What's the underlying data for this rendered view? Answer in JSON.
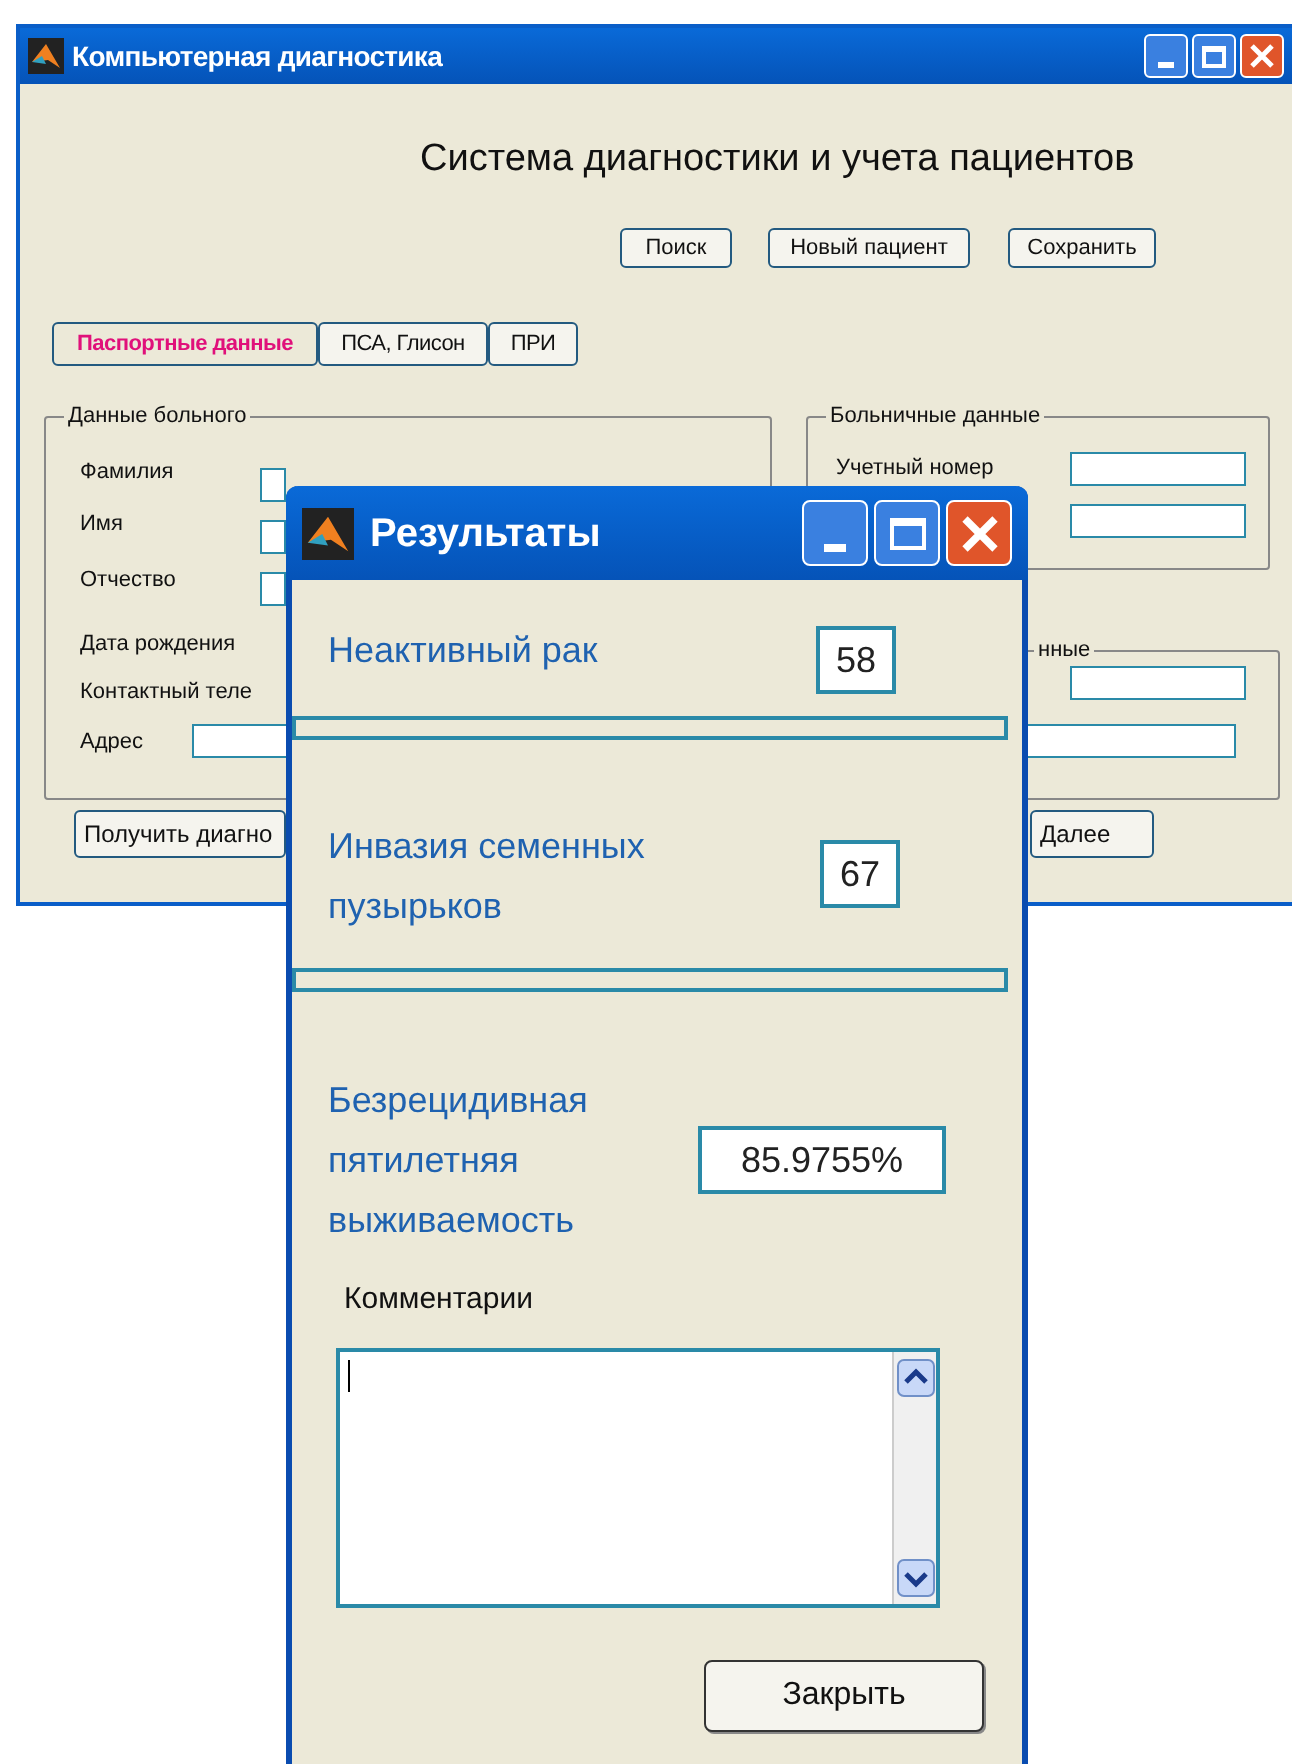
{
  "main_window": {
    "title": "Компьютерная диагностика",
    "heading": "Система диагностики и учета пациентов",
    "toolbar_buttons": [
      "Поиск",
      "Новый пациент",
      "Сохранить"
    ],
    "tabs": [
      {
        "label": "Паспортные данные",
        "selected": true
      },
      {
        "label": "ПСА, Глисон",
        "selected": false
      },
      {
        "label": "ПРИ",
        "selected": false
      }
    ],
    "patient_group": {
      "title": "Данные больного",
      "fields": [
        "Фамилия",
        "Имя",
        "Отчество",
        "Дата рождения",
        "Контактный теле",
        "Адрес"
      ]
    },
    "hospital_group": {
      "title": "Больничные данные",
      "fields": [
        "Учетный номер"
      ]
    },
    "third_group": {
      "title": "нные"
    },
    "buttons": [
      "Получить диагно",
      "Далее"
    ]
  },
  "results_window": {
    "title": "Результаты",
    "items": [
      {
        "label": "Неактивный рак",
        "value": "58"
      },
      {
        "label": "Инвазия семенных пузырьков",
        "value": "67"
      },
      {
        "label": "Безрецидивная пятилетняя выживаемость",
        "value": "85.9755%"
      }
    ],
    "comments_label": "Комментарии",
    "close_button": "Закрыть"
  }
}
